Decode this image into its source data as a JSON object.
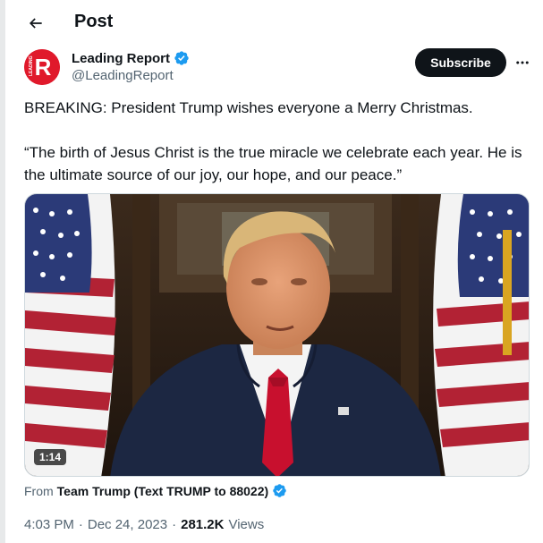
{
  "header": {
    "title": "Post"
  },
  "author": {
    "name": "Leading Report",
    "handle": "@LeadingReport",
    "avatar_letter": "R",
    "avatar_small_text": "LEADING",
    "verified": true
  },
  "subscribe_label": "Subscribe",
  "tweet": {
    "line1": "BREAKING: President Trump wishes everyone a Merry Christmas.",
    "line2": "“The birth of Jesus Christ is the true miracle we celebrate each year. He is the ultimate source of our joy, our hope, and our peace.”"
  },
  "media": {
    "duration": "1:14"
  },
  "from": {
    "prefix": "From",
    "source": "Team Trump (Text TRUMP to 88022)"
  },
  "meta": {
    "time": "4:03 PM",
    "separator": "·",
    "date": "Dec 24, 2023",
    "views_count": "281.2K",
    "views_label": "Views"
  },
  "colors": {
    "brand": "#e0192b",
    "verified": "#1d9bf0",
    "text": "#0f1419",
    "secondary": "#536471"
  }
}
